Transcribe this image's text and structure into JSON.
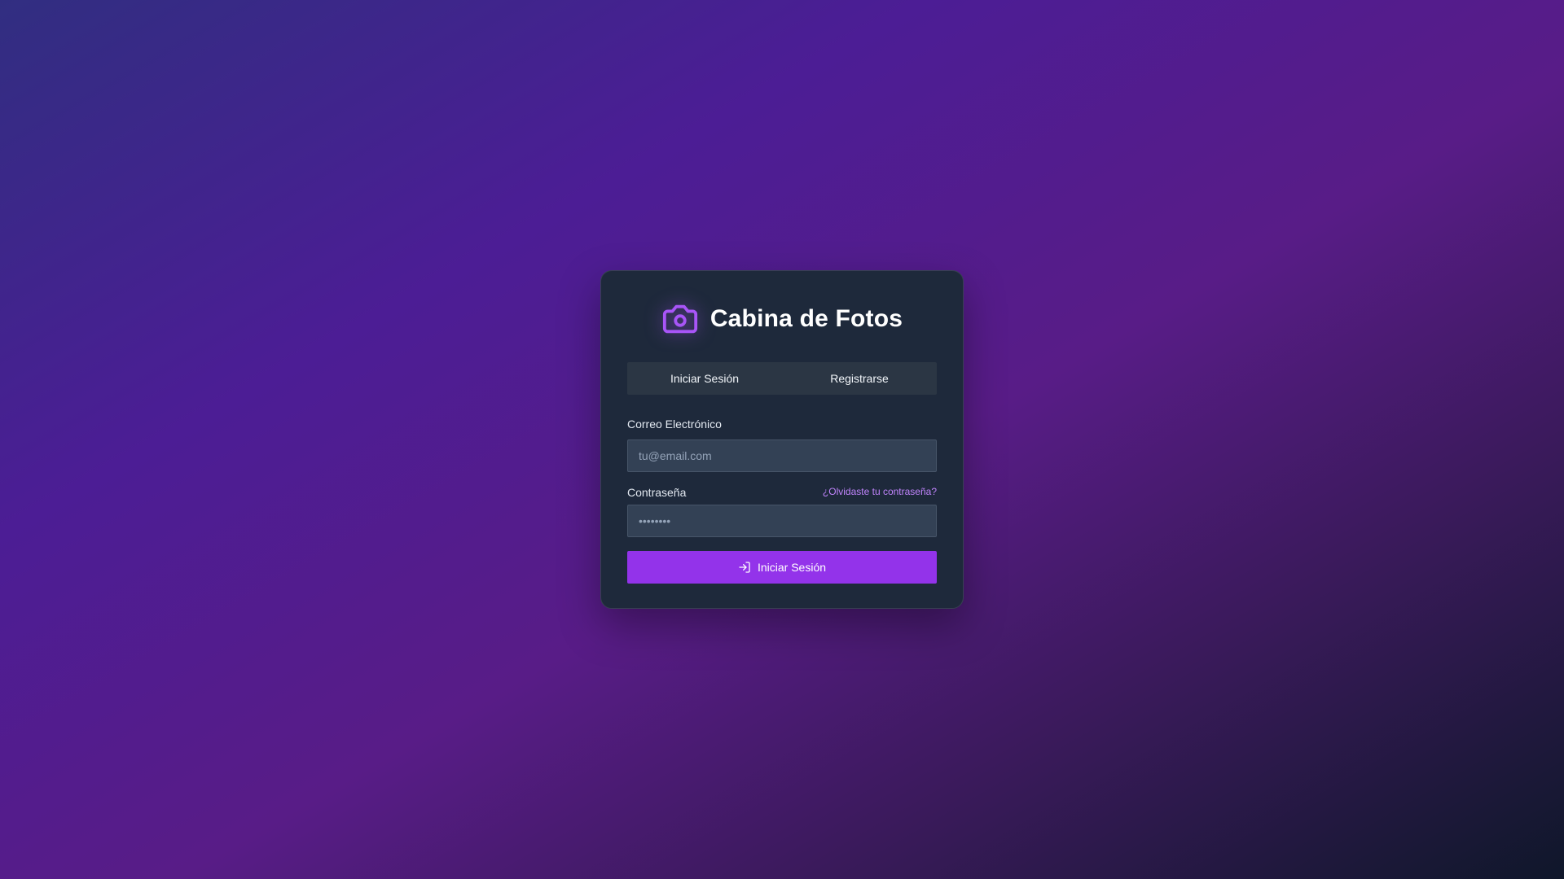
{
  "app": {
    "title": "Cabina de Fotos",
    "icon": "camera-icon",
    "accent_color": "#a855f7",
    "button_color": "#9333ea"
  },
  "tabs": [
    {
      "label": "Iniciar Sesión",
      "active": true
    },
    {
      "label": "Registrarse",
      "active": false
    }
  ],
  "form": {
    "email": {
      "label": "Correo Electrónico",
      "placeholder": "tu@email.com",
      "value": ""
    },
    "password": {
      "label": "Contraseña",
      "placeholder": "••••••••",
      "value": "",
      "forgot_link": "¿Olvidaste tu contraseña?"
    },
    "submit": {
      "label": "Iniciar Sesión",
      "icon": "login-icon"
    }
  }
}
